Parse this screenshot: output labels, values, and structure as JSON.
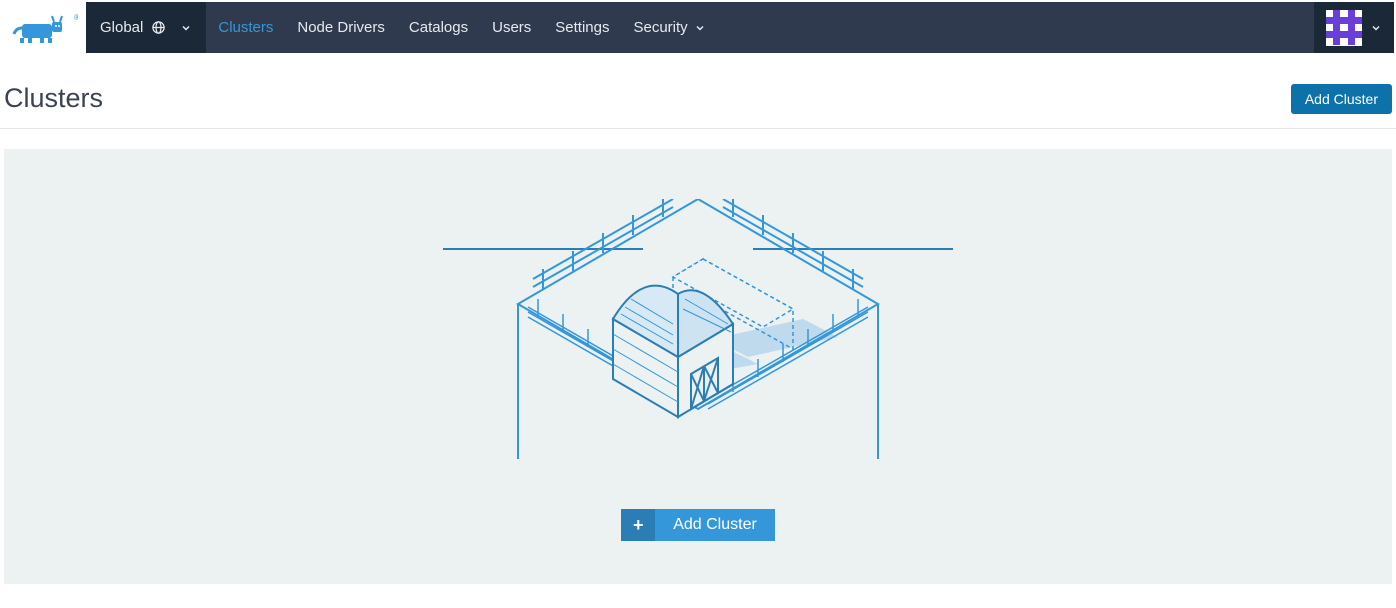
{
  "scope": {
    "label": "Global"
  },
  "nav": {
    "clusters": "Clusters",
    "node_drivers": "Node Drivers",
    "catalogs": "Catalogs",
    "users": "Users",
    "settings": "Settings",
    "security": "Security"
  },
  "page": {
    "title": "Clusters",
    "add_button": "Add Cluster",
    "empty_add_button": "Add Cluster"
  }
}
